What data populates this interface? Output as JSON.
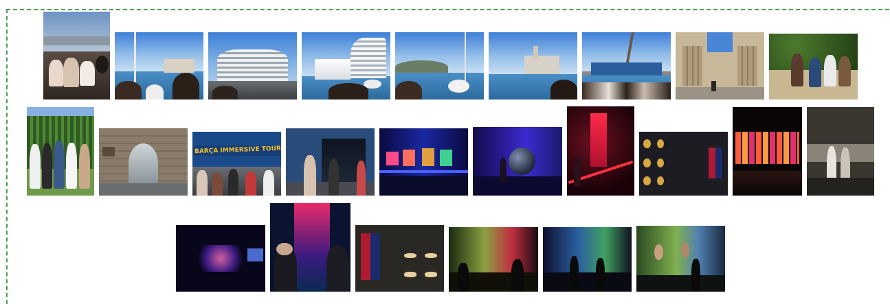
{
  "gallery": {
    "title": "",
    "rows": [
      {
        "photos": [
          {
            "scene": "boat-deck-selfie"
          },
          {
            "scene": "harbor-view"
          },
          {
            "scene": "modern-building"
          },
          {
            "scene": "cruise-ship"
          },
          {
            "scene": "mountain-coast"
          },
          {
            "scene": "port-industrial"
          },
          {
            "scene": "cargo-ship"
          },
          {
            "scene": "gothic-courtyard"
          },
          {
            "scene": "park-group"
          }
        ]
      },
      {
        "photos": [
          {
            "scene": "garden-group"
          },
          {
            "scene": "stone-archway"
          },
          {
            "scene": "barca-immersive-tour-entrance",
            "sign_text": "BARÇA IMMERSIVE TOUR"
          },
          {
            "scene": "tour-hallway"
          },
          {
            "scene": "blue-screens-hall"
          },
          {
            "scene": "sphere-exhibit"
          },
          {
            "scene": "red-neon-display"
          },
          {
            "scene": "trophy-shirts"
          },
          {
            "scene": "led-wall"
          },
          {
            "scene": "glass-cases"
          }
        ]
      },
      {
        "photos": [
          {
            "scene": "dark-gallery"
          },
          {
            "scene": "player-screen-selfie"
          },
          {
            "scene": "shirt-boots-case"
          },
          {
            "scene": "immersive-room-1"
          },
          {
            "scene": "immersive-room-2"
          },
          {
            "scene": "immersive-room-3"
          }
        ]
      }
    ]
  }
}
